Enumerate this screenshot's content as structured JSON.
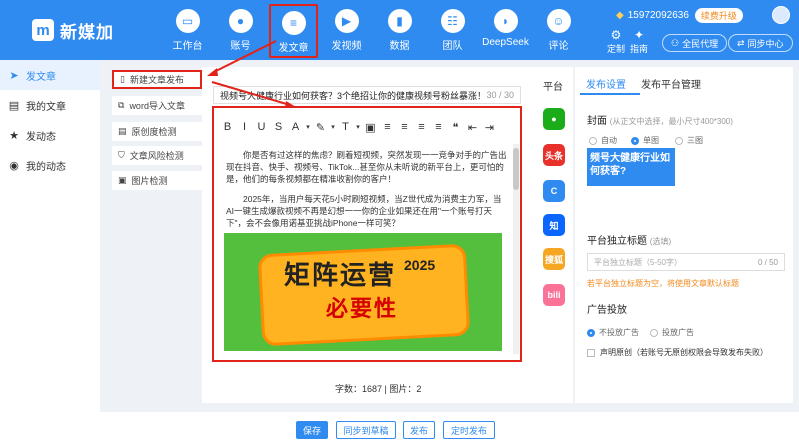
{
  "app": {
    "name": "新媒加",
    "logo_char": "m"
  },
  "nav": [
    {
      "label": "工作台",
      "icon": "monitor-icon",
      "glyph": "▭"
    },
    {
      "label": "账号",
      "icon": "user-icon",
      "glyph": "●"
    },
    {
      "label": "发文章",
      "icon": "document-icon",
      "glyph": "≡",
      "active": true
    },
    {
      "label": "发视频",
      "icon": "video-icon",
      "glyph": "▶"
    },
    {
      "label": "数据",
      "icon": "bar-chart-icon",
      "glyph": "▮"
    },
    {
      "label": "团队",
      "icon": "team-icon",
      "glyph": "☷"
    },
    {
      "label": "DeepSeek",
      "icon": "deepseek-icon",
      "glyph": "◗"
    },
    {
      "label": "评论",
      "icon": "comment-icon",
      "glyph": "☺"
    }
  ],
  "user": {
    "phone": "15972092636",
    "upgrade": "续费升级"
  },
  "top_right": {
    "customize": "定制",
    "guide": "指南",
    "agent": "全民代理",
    "sync": "同步中心"
  },
  "sidebar": [
    {
      "label": "发文章",
      "icon": "send-icon",
      "glyph": "➤",
      "active": true
    },
    {
      "label": "我的文章",
      "icon": "file-icon",
      "glyph": "▤"
    },
    {
      "label": "发动态",
      "icon": "star-icon",
      "glyph": "★"
    },
    {
      "label": "我的动态",
      "icon": "circle-icon",
      "glyph": "◉"
    }
  ],
  "tools": [
    {
      "label": "新建文章发布",
      "icon": "new-file-icon",
      "glyph": "▯"
    },
    {
      "label": "word导入文章",
      "icon": "word-icon",
      "glyph": "⧉"
    },
    {
      "label": "原创度检测",
      "icon": "check-doc-icon",
      "glyph": "▤"
    },
    {
      "label": "文章风险检测",
      "icon": "shield-icon",
      "glyph": "⛉"
    },
    {
      "label": "图片检测",
      "icon": "image-icon",
      "glyph": "▣"
    }
  ],
  "editor": {
    "title": "视频号大健康行业如何获客？3个绝招让你的健康视频号粉丝暴涨！",
    "title_count": "30 / 30",
    "toolbar": [
      "B",
      "I",
      "U",
      "S",
      "A",
      "▾",
      "✎",
      "▾",
      "T",
      "▾",
      "▣",
      "≡",
      "≡",
      "≡",
      "≡",
      "❝",
      "⇤",
      "⇥"
    ],
    "paragraph1": "你是否有过这样的焦虑？刷着短视频，突然发现一一竞争对手的广告出现在抖音、快手、视频号、TikTok...甚至你从未听说的新平台上，更可怕的是，他们的每条视频都在精准收割你的客户！",
    "paragraph2": "2025年，当用户每天花5小时刷短视频，当Z世代成为消费主力军，当AI一键生成爆款视频不再是幻想一一你的企业如果还在用\"一个账号打天下\"，会不会像用诺基亚挑战iPhone一样可笑？",
    "banner_line1": "矩阵运营",
    "banner_year": "2025",
    "banner_line2": "必要性",
    "word_count": "字数：1687 | 图片：2"
  },
  "platforms": {
    "label": "平台",
    "items": [
      {
        "name": "wechat-icon",
        "glyph": "●",
        "color": "#1aad19"
      },
      {
        "name": "toutiao-icon",
        "glyph": "头条",
        "color": "#e8312a"
      },
      {
        "name": "c-platform-icon",
        "glyph": "C",
        "color": "#2f8bf0"
      },
      {
        "name": "zhihu-icon",
        "glyph": "知",
        "color": "#0a66ff"
      },
      {
        "name": "sohu-icon",
        "glyph": "搜狐",
        "color": "#f5a623"
      },
      {
        "name": "bilibili-icon",
        "glyph": "bili",
        "color": "#fb7299"
      }
    ]
  },
  "settings": {
    "tabs": [
      "发布设置",
      "发布平台管理"
    ],
    "cover_label": "封面",
    "cover_hint": "(从正文中选择，最小尺寸400*300)",
    "cover_options": [
      "自动",
      "单图",
      "三图"
    ],
    "cover_text": "频号大健康行业如何获客?",
    "indep_title_label": "平台独立标题",
    "indep_title_hint": "(选填)",
    "indep_title_placeholder": "平台独立标题（5-50字）",
    "indep_title_count": "0 / 50",
    "warn": "若平台独立标题为空，将使用文章默认标题",
    "ad_label": "广告投放",
    "ad_options": [
      "不投放广告",
      "投放广告"
    ],
    "original": "声明原创（若账号无原创权限会导致发布失败）"
  },
  "buttons": {
    "save": "保存",
    "sync_draft": "同步到草稿",
    "publish": "发布",
    "schedule": "定时发布"
  },
  "colors": {
    "brand": "#2f8bf0",
    "highlight": "#e2231a",
    "warning": "#f08a1d"
  }
}
